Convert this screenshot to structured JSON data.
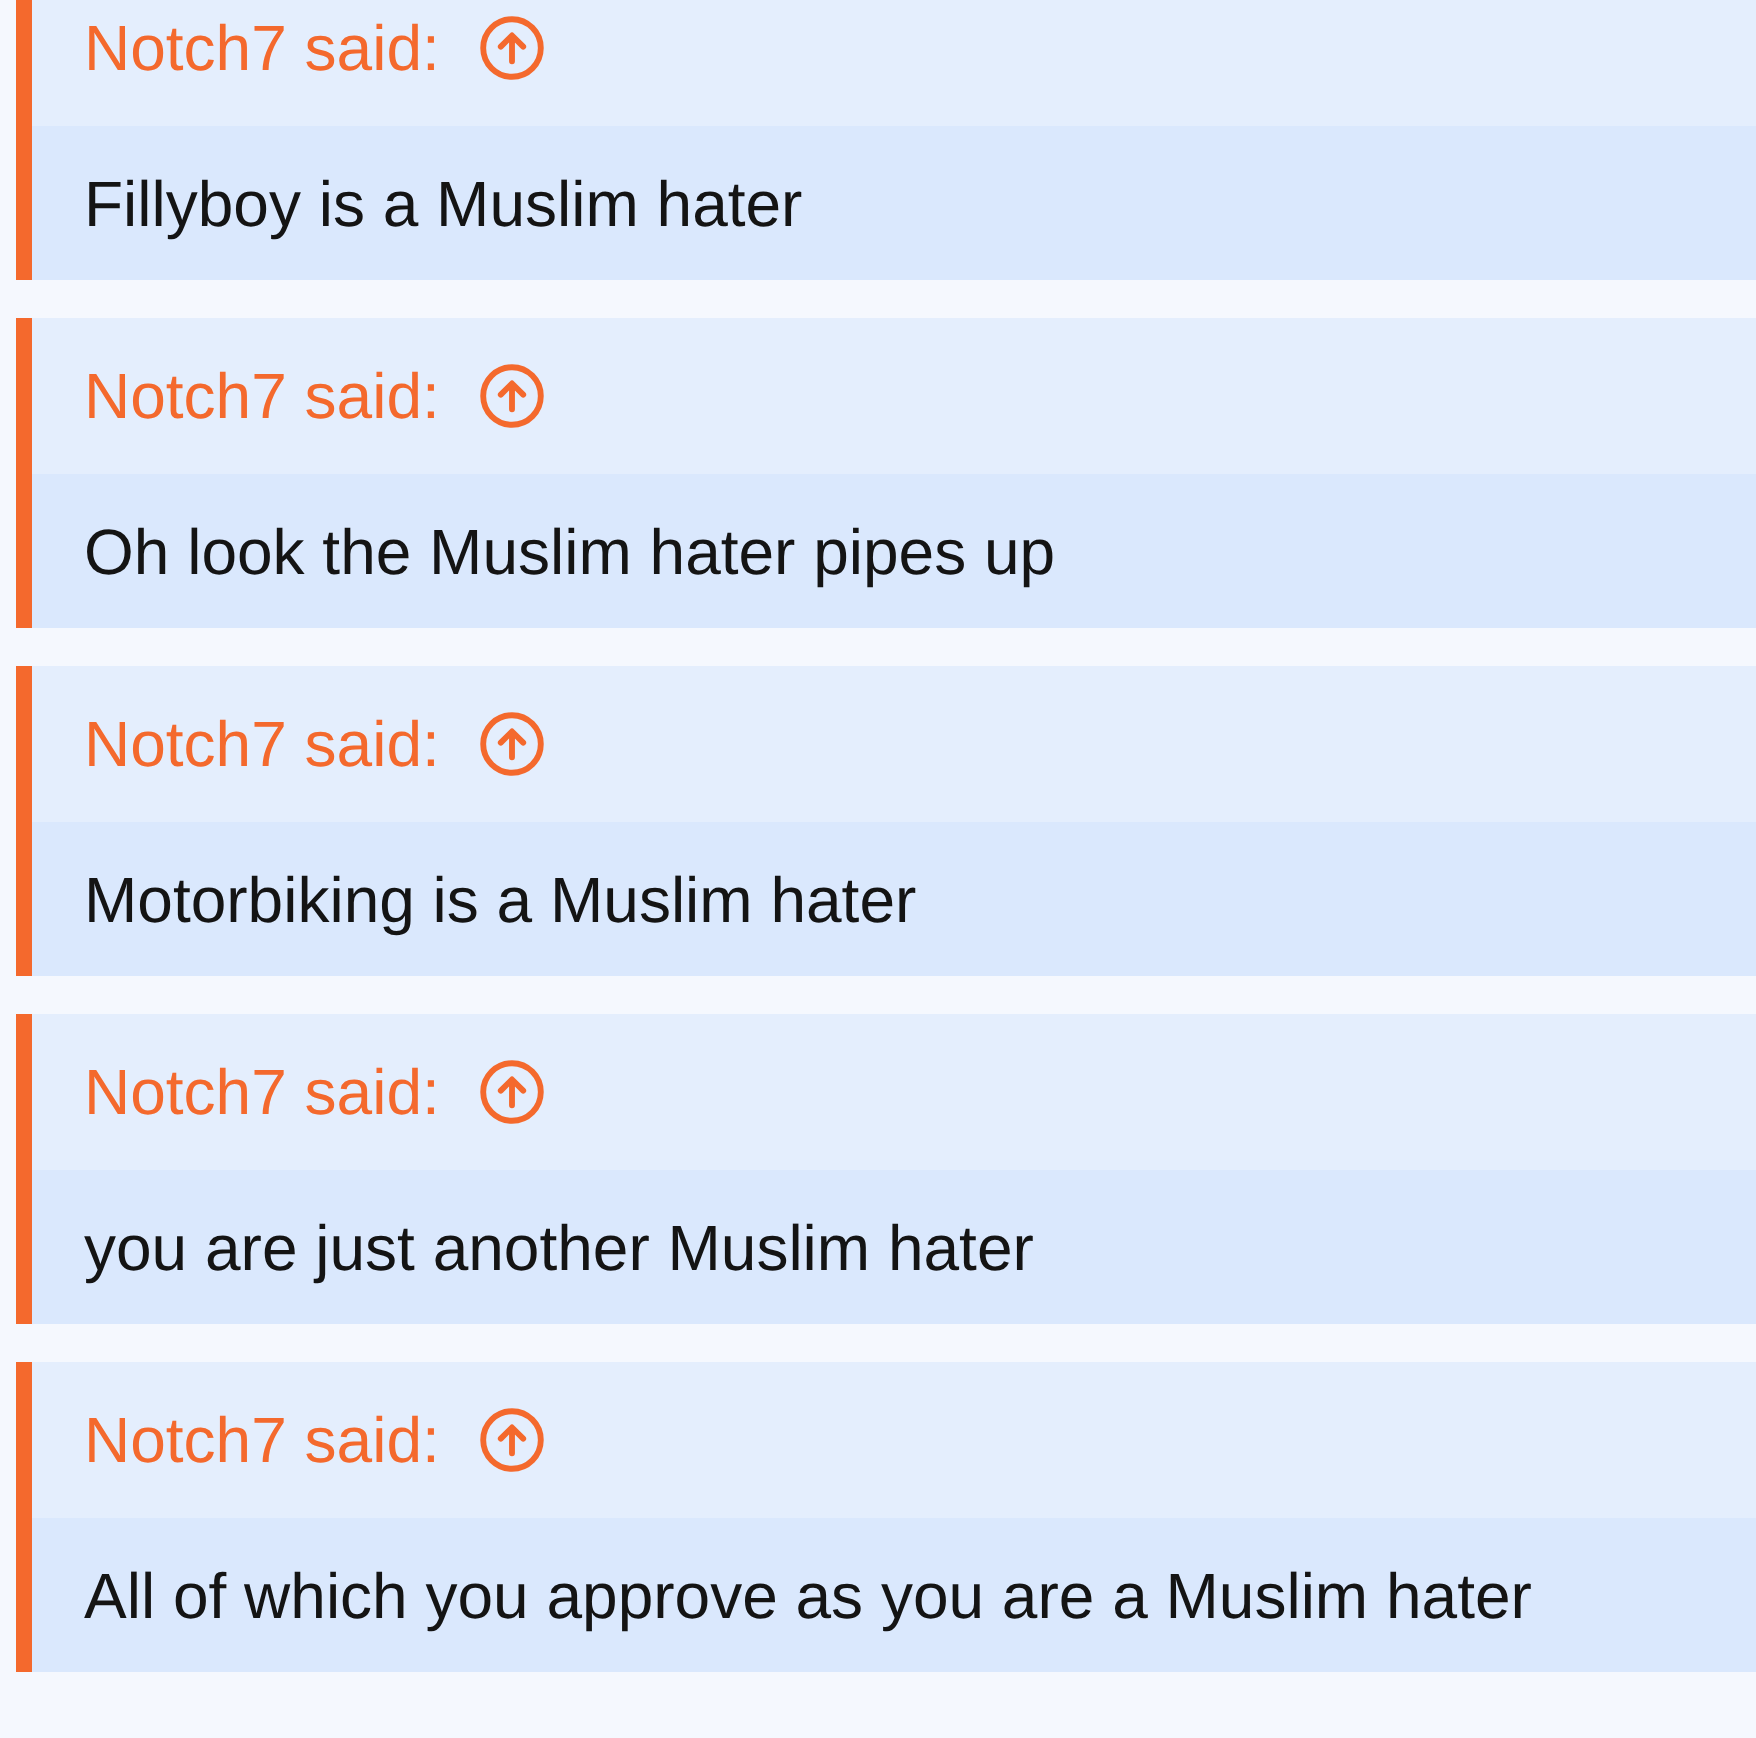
{
  "quotes": [
    {
      "author_line": "Notch7 said:",
      "text": "Fillyboy is a Muslim hater"
    },
    {
      "author_line": "Notch7 said:",
      "text": "Oh look the Muslim hater pipes up"
    },
    {
      "author_line": "Notch7 said:",
      "text": "Motorbiking is a Muslim hater"
    },
    {
      "author_line": "Notch7 said:",
      "text": "you are just another Muslim hater"
    },
    {
      "author_line": "Notch7 said:",
      "text": "All of which you approve as you are a Muslim hater"
    }
  ]
}
